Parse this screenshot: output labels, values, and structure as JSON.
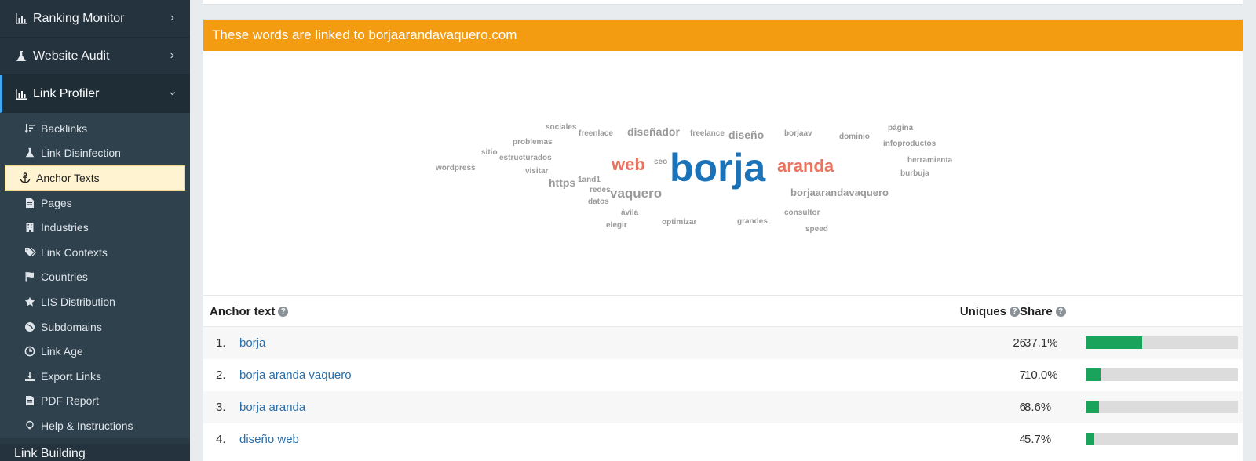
{
  "sidebar": {
    "top_items": [
      {
        "label": "Ranking Monitor"
      },
      {
        "label": "Website Audit"
      },
      {
        "label": "Link Profiler"
      }
    ],
    "sub_items": [
      {
        "label": "Backlinks"
      },
      {
        "label": "Link Disinfection"
      },
      {
        "label": "Anchor Texts"
      },
      {
        "label": "Pages"
      },
      {
        "label": "Industries"
      },
      {
        "label": "Link Contexts"
      },
      {
        "label": "Countries"
      },
      {
        "label": "LIS Distribution"
      },
      {
        "label": "Subdomains"
      },
      {
        "label": "Link Age"
      },
      {
        "label": "Export Links"
      },
      {
        "label": "PDF Report"
      },
      {
        "label": "Help & Instructions"
      }
    ],
    "bottom_item": {
      "label": "Link Building"
    }
  },
  "panel": {
    "title": "These words are linked to borjaarandavaquero.com"
  },
  "colors": {
    "accent": "#f39c12",
    "primary_word": "#1a73b8",
    "secondary_word": "#e8735f",
    "bar_fill": "#1aa35a"
  },
  "cloud_words": [
    "sociales",
    "freenlace",
    "diseñador",
    "freelance",
    "diseño",
    "borjaav",
    "dominio",
    "página",
    "problemas",
    "infoproductos",
    "sitio",
    "estructurados",
    "seo",
    "herramienta",
    "wordpress",
    "web",
    "borja",
    "aranda",
    "visitar",
    "burbuja",
    "1and1",
    "https",
    "redes",
    "vaquero",
    "borjaarandavaquero",
    "datos",
    "ávila",
    "consultor",
    "optimizar",
    "grandes",
    "elegir",
    "speed"
  ],
  "table": {
    "headers": {
      "anchor": "Anchor text",
      "uniques": "Uniques",
      "share": "Share"
    },
    "rows": [
      {
        "num": "1.",
        "anchor": "borja",
        "uniques": "26",
        "share": "37.1%",
        "share_value": 0.371
      },
      {
        "num": "2.",
        "anchor": "borja aranda vaquero",
        "uniques": "7",
        "share": "10.0%",
        "share_value": 0.1
      },
      {
        "num": "3.",
        "anchor": "borja aranda",
        "uniques": "6",
        "share": "8.6%",
        "share_value": 0.086
      },
      {
        "num": "4.",
        "anchor": "diseño web",
        "uniques": "4",
        "share": "5.7%",
        "share_value": 0.057
      }
    ]
  }
}
